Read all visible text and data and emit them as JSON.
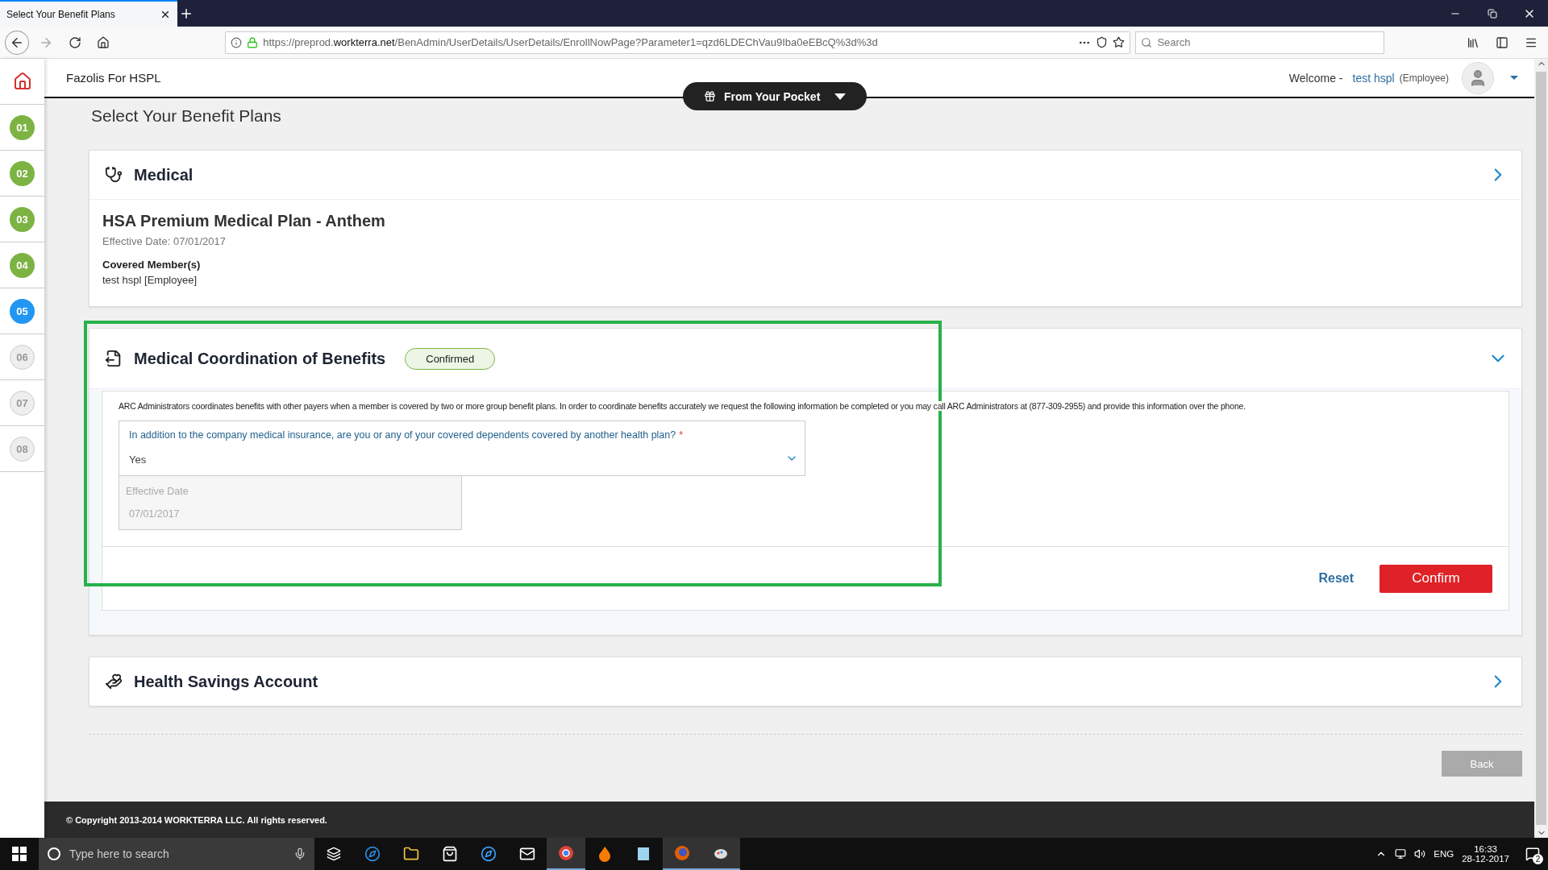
{
  "browser": {
    "tab_title": "Select Your Benefit Plans",
    "url": "https://preprod.**workterra.net**/BenAdmin/UserDetails/UserDetails/EnrollNowPage?Parameter1=qzd6LDEChVau9Iba0eEBcQ%3d%3d",
    "search_placeholder": "Search"
  },
  "sidebar": {
    "steps": [
      {
        "label": "01",
        "completed": true,
        "selected": false
      },
      {
        "label": "02",
        "completed": true,
        "selected": false
      },
      {
        "label": "03",
        "completed": true,
        "selected": false
      },
      {
        "label": "04",
        "completed": true,
        "selected": false
      },
      {
        "label": "05",
        "completed": false,
        "selected": true
      },
      {
        "label": "06",
        "completed": false,
        "selected": false
      },
      {
        "label": "07",
        "completed": false,
        "selected": false
      },
      {
        "label": "08",
        "completed": false,
        "selected": false
      }
    ]
  },
  "header": {
    "company": "Fazolis For HSPL",
    "pocket_button": "From Your Pocket",
    "welcome": "Welcome -",
    "user_name": "test hspl",
    "user_role": "(Employee)"
  },
  "page_title": "Select Your Benefit Plans",
  "sections": [
    {
      "kind": "summary",
      "title": "Medical",
      "expanded": false,
      "plan_name": "HSA Premium Medical Plan - Anthem",
      "effective": "Effective Date: 07/01/2017",
      "covered_label": "Covered Member(s)",
      "covered_member": "test hspl [Employee]"
    },
    {
      "kind": "form",
      "title": "Medical Coordination of Benefits",
      "expanded": true,
      "badge": "Confirmed",
      "highlighted": true,
      "notice": "ARC Administrators coordinates benefits with other payers when a member is covered by two or more group benefit plans. In order to coordinate benefits accurately we request the following information be completed or you may call ARC Administrators at (877-309-2955) and provide this information over the phone.",
      "question": "In addition to the company medical insurance, are you or any of your covered dependents covered by another health plan?",
      "required_mark": "*",
      "answer": "Yes",
      "date_label": "Effective Date",
      "date_value": "07/01/2017",
      "reset": "Reset",
      "confirm": "Confirm"
    },
    {
      "kind": "collapsed",
      "title": "Health Savings Account",
      "expanded": false
    }
  ],
  "back_button": "Back",
  "footer": "© Copyright 2013-2014 WORKTERRA LLC. All rights reserved.",
  "taskbar": {
    "search_placeholder": "Type here to search",
    "language": "ENG",
    "time": "16:33",
    "date": "28-12-2017",
    "notifications": "2"
  }
}
